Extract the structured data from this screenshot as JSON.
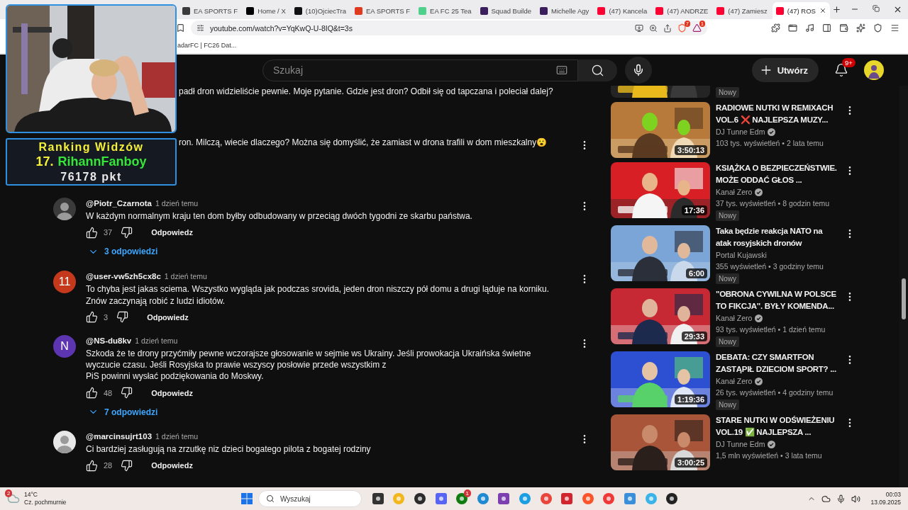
{
  "browser": {
    "tabs": [
      {
        "title": "EA SPORTS F",
        "color": "#3a3a3a",
        "selected": false
      },
      {
        "title": "Home / X",
        "color": "#000000",
        "selected": false
      },
      {
        "title": "(10)OjciecTra",
        "color": "#111111",
        "selected": false
      },
      {
        "title": "EA SPORTS F",
        "color": "#e03a1e",
        "selected": false
      },
      {
        "title": "EA FC 25 Tea",
        "color": "#4fd18b",
        "selected": false
      },
      {
        "title": "Squad Builde",
        "color": "#3a1f5c",
        "selected": false
      },
      {
        "title": "Michelle Agy",
        "color": "#3a1f5c",
        "selected": false
      },
      {
        "title": "(47) Kancela",
        "color": "#ff0033",
        "selected": false
      },
      {
        "title": "(47) ANDRZE",
        "color": "#ff0033",
        "selected": false
      },
      {
        "title": "(47) Zamiesz",
        "color": "#ff0033",
        "selected": false
      },
      {
        "title": "(47) ROS",
        "color": "#ff0033",
        "selected": true
      }
    ],
    "address": "youtube.com/watch?v=YqKwQ-U-8IQ&t=3s",
    "shield_count": "7",
    "bat_count": "1",
    "bookmarks": [
      "adarFC | FC26 Dat..."
    ]
  },
  "stream_overlay": {
    "ranking_title": "Ranking Widzów",
    "rank": "17.",
    "viewer": "RihannFanboy",
    "points": "76178 pkt"
  },
  "youtube_header": {
    "search_placeholder": "Szukaj",
    "create_label": "Utwórz",
    "notification_count": "9+"
  },
  "comments": [
    {
      "kind": "partial",
      "text": "padł dron widzieliście pewnie. Moje pytanie. Gdzie jest dron? Odbił się od tapczana i poleciał dalej?",
      "more_menu": false
    },
    {
      "kind": "partial",
      "text": "ron. Milczą, wiecie dlaczego? Można się domyślić, że zamiast w drona trafili w dom mieszkalny😮",
      "more_menu": true
    },
    {
      "kind": "full",
      "author": "@Piotr_Czarnota",
      "time": "1 dzień temu",
      "text": "W każdym normalnym kraju ten dom byłby odbudowany w przeciąg dwóch tygodni ze skarbu państwa.",
      "likes": "37",
      "reply_label": "Odpowiedz",
      "replies": "3 odpowiedzi",
      "more_menu": true
    },
    {
      "kind": "full",
      "avatar": {
        "kind": "letter",
        "letter": "11",
        "color": "#c4391c"
      },
      "author": "@user-vw5zh5cx8c",
      "time": "1 dzień temu",
      "text": "To chyba jest jakas sciema. Wszystko wygląda jak podczas srovida, jeden dron niszczy pół domu a drugi ląduje na korniku. Znów zaczynają robić z ludzi idiotów.",
      "likes": "3",
      "reply_label": "Odpowiedz",
      "more_menu": true
    },
    {
      "kind": "full",
      "avatar": {
        "kind": "letter",
        "letter": "N",
        "color": "#5e35b1"
      },
      "author": "@NS-du8kv",
      "time": "1 dzień temu",
      "text": "Szkoda że te drony przyćmiły pewne wczorajsze głosowanie w sejmie ws Ukrainy. Jeśli prowokacja Ukraińska świetne wyczucie czasu. Jeśli Rosyjska to prawie wszyscy posłowie przede wszystkim z\nPiS powinni wysłać podziękowania do Moskwy.",
      "likes": "48",
      "reply_label": "Odpowiedz",
      "replies": "7 odpowiedzi",
      "more_menu": true
    },
    {
      "kind": "full",
      "author": "@marcinsujrt103",
      "time": "1 dzień temu",
      "text": "Ci bardziej zasługują na zrzutkę niz dzieci bogatego pilota z bogatej rodziny",
      "likes": "28",
      "reply_label": "Odpowiedz",
      "more_menu": true
    }
  ],
  "recommended": [
    {
      "kind": "partial",
      "badge": "Nowy"
    },
    {
      "kind": "full",
      "title": "RADIOWE NUTKI W REMIXACH VOL.6 ❌ NAJLEPSZA MUZY...",
      "channel": "DJ Tunne Edm",
      "verified": true,
      "stats": "103 tys. wyświetleń • 2 lata temu",
      "duration": "3:50:13"
    },
    {
      "kind": "full",
      "title": "KSIĄŻKA O BEZPIECZEŃSTWIE. MOŻE ODDAĆ GŁOS ...",
      "channel": "Kanał Zero",
      "verified": true,
      "stats": "37 tys. wyświetleń • 8 godzin temu",
      "badge": "Nowy",
      "duration": "17:36"
    },
    {
      "kind": "full",
      "title": "Taka będzie reakcja NATO na atak rosyjskich dronów",
      "channel": "Portal Kujawski",
      "verified": false,
      "stats": "355 wyświetleń • 3 godziny temu",
      "badge": "Nowy",
      "duration": "6:00"
    },
    {
      "kind": "full",
      "title": "\"OBRONA CYWILNA W POLSCE TO FIKCJA\". BYŁY KOMENDA...",
      "channel": "Kanał Zero",
      "verified": true,
      "stats": "93 tys. wyświetleń • 1 dzień temu",
      "badge": "Nowy",
      "duration": "29:33"
    },
    {
      "kind": "full",
      "title": "DEBATA: CZY SMARTFON ZASTĄPIŁ DZIECIOM SPORT? ...",
      "channel": "Kanał Zero",
      "verified": true,
      "stats": "26 tys. wyświetleń • 4 godziny temu",
      "badge": "Nowy",
      "duration": "1:19:36"
    },
    {
      "kind": "full",
      "title": "STARE NUTKI W ODŚWIEŻENIU VOL.19 ✅ NAJLEPSZA ...",
      "channel": "DJ Tunne Edm",
      "verified": true,
      "stats": "1,5 mln wyświetleń • 3 lata temu",
      "duration": "3:00:25"
    }
  ],
  "taskbar": {
    "weather_badge": "2",
    "temperature": "14°C",
    "weather": "Cz. pochmurnie",
    "search_placeholder": "Wyszukaj",
    "app_badge": "1",
    "time": "00:03",
    "date": "13.09.2025"
  }
}
